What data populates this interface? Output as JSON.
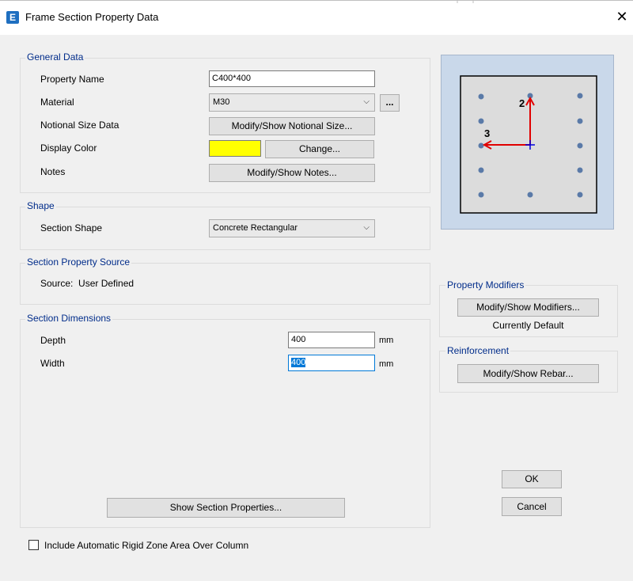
{
  "window": {
    "title": "Frame Section Property Data",
    "app_icon": "E",
    "close_glyph": "✕"
  },
  "general_data": {
    "heading": "General Data",
    "property_name_label": "Property Name",
    "property_name_value": "C400*400",
    "material_label": "Material",
    "material_value": "M30",
    "material_more_button": "...",
    "notional_label": "Notional Size Data",
    "notional_button": "Modify/Show Notional Size...",
    "display_color_label": "Display Color",
    "display_color_value": "#ffff00",
    "change_button": "Change...",
    "notes_label": "Notes",
    "notes_button": "Modify/Show Notes..."
  },
  "shape": {
    "heading": "Shape",
    "section_shape_label": "Section Shape",
    "section_shape_value": "Concrete Rectangular"
  },
  "source": {
    "heading": "Section Property Source",
    "text": "Source:  User Defined"
  },
  "dimensions": {
    "heading": "Section Dimensions",
    "depth_label": "Depth",
    "depth_value": "400",
    "depth_unit": "mm",
    "width_label": "Width",
    "width_value": "400",
    "width_unit": "mm",
    "show_properties_button": "Show Section Properties..."
  },
  "preview": {
    "axis2_label": "2",
    "axis3_label": "3"
  },
  "property_modifiers": {
    "heading": "Property Modifiers",
    "button": "Modify/Show Modifiers...",
    "status": "Currently Default"
  },
  "reinforcement": {
    "heading": "Reinforcement",
    "button": "Modify/Show Rebar..."
  },
  "footer": {
    "ok": "OK",
    "cancel": "Cancel",
    "rigid_zone_label": "Include Automatic Rigid Zone Area Over Column",
    "rigid_zone_checked": false
  }
}
